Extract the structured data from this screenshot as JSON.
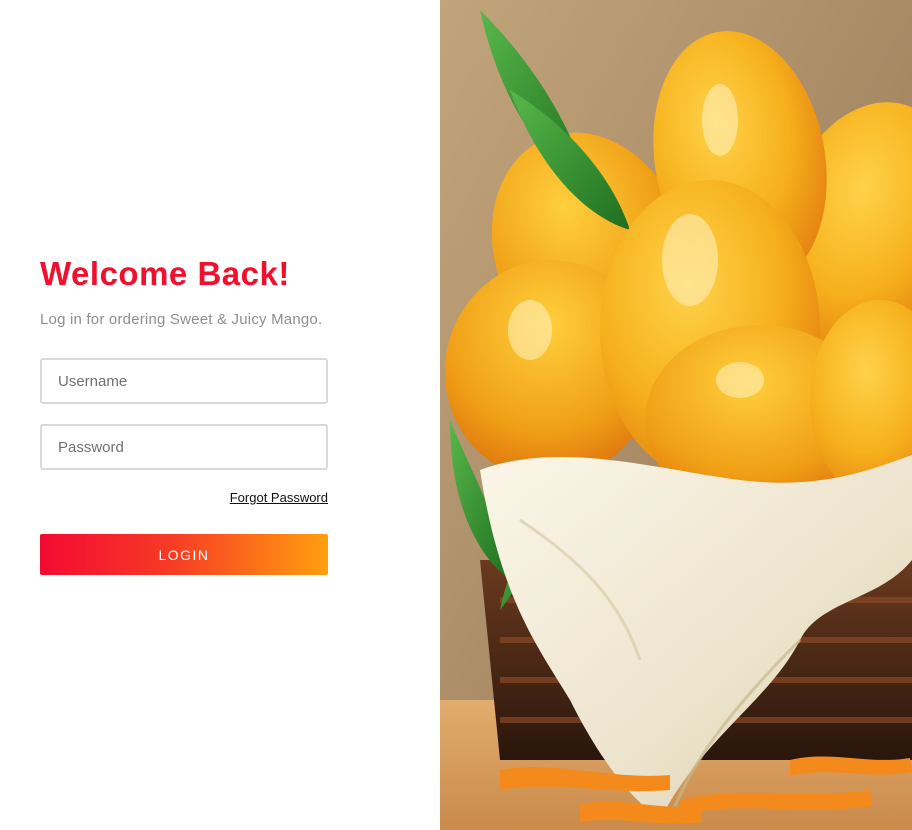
{
  "login": {
    "title": "Welcome Back!",
    "subtitle": "Log in for ordering Sweet & Juicy Mango.",
    "username_placeholder": "Username",
    "password_placeholder": "Password",
    "forgot_label": "Forgot Password",
    "submit_label": "LOGIN"
  },
  "colors": {
    "title": "#f0102e",
    "button_gradient_start": "#f30a32",
    "button_gradient_end": "#ff9f0e",
    "mango_yellow": "#f4b21a",
    "mango_orange": "#e8801a",
    "leaf_green": "#2f8f2a",
    "cloth": "#f1ebd9"
  },
  "hero": {
    "subject": "basket of mangoes with leaves and cloth"
  }
}
